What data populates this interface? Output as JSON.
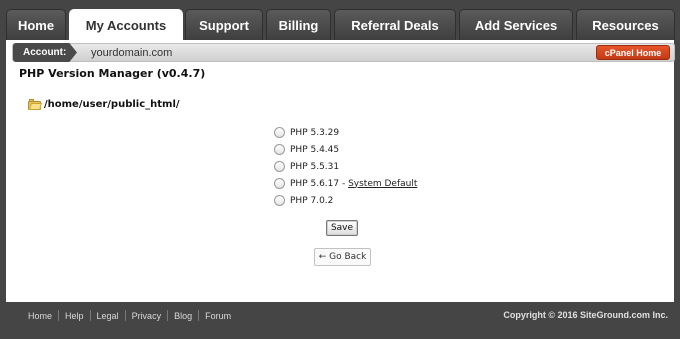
{
  "nav": {
    "tabs": [
      {
        "label": "Home",
        "active": false
      },
      {
        "label": "My Accounts",
        "active": true
      },
      {
        "label": "Support",
        "active": false
      },
      {
        "label": "Billing",
        "active": false
      },
      {
        "label": "Referral Deals",
        "active": false
      },
      {
        "label": "Add Services",
        "active": false
      },
      {
        "label": "Resources",
        "active": false
      }
    ]
  },
  "account": {
    "label": "Account:",
    "domain": "yourdomain.com",
    "cpanel_button": "cPanel Home"
  },
  "page": {
    "title": "PHP Version Manager (v0.4.7)",
    "path": "/home/user/public_html/",
    "folder_icon": "folder-icon"
  },
  "php_versions": [
    {
      "label": "PHP 5.3.29",
      "default_label": ""
    },
    {
      "label": "PHP 5.4.45",
      "default_label": ""
    },
    {
      "label": "PHP 5.5.31",
      "default_label": ""
    },
    {
      "label": "PHP 5.6.17 - ",
      "default_label": "System Default"
    },
    {
      "label": "PHP 7.0.2",
      "default_label": ""
    }
  ],
  "actions": {
    "save": "Save",
    "back": "← Go Back"
  },
  "footer": {
    "links": [
      "Home",
      "Help",
      "Legal",
      "Privacy",
      "Blog",
      "Forum"
    ],
    "copyright": "Copyright © 2016 SiteGround.com Inc."
  },
  "colors": {
    "accent": "#d9481f",
    "dark_bg": "#454545"
  }
}
